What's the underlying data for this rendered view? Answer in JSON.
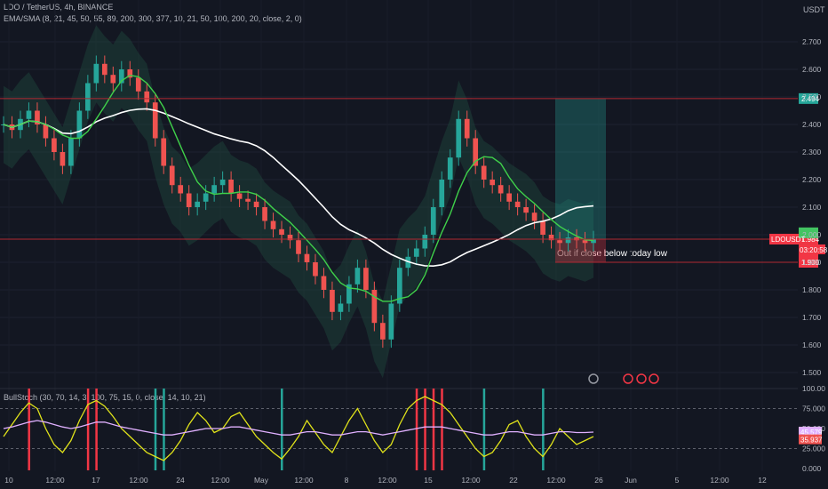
{
  "header": {
    "title": "LDO / TetherUS, 4h, BINANCE",
    "indicator": "EMA/SMA (8, 21, 45, 50, 55, 89, 200, 300, 377, 10, 21, 50, 100, 200, 20, close, 2, 0)",
    "currency": "USDT",
    "sub_indicator": "BullStoch (30, 70, 14, 3, 100, 75, 15, 0, close, 14, 10, 21)"
  },
  "chart_data": [
    {
      "type": "candlestick",
      "title": "LDO / TetherUS, 4h, BINANCE",
      "ylabel": "USDT",
      "ylim": [
        1.5,
        2.8
      ],
      "yticks": [
        "2.700",
        "2.600",
        "2.500",
        "2.400",
        "2.300",
        "2.200",
        "2.100",
        "2.000",
        "1.900",
        "1.800",
        "1.700",
        "1.600",
        "1.500"
      ],
      "xtick_labels": [
        "10",
        "12:00",
        "17",
        "12:00",
        "24",
        "12:00",
        "May",
        "12:00",
        "8",
        "12:00",
        "15",
        "12:00",
        "22",
        "12:00",
        "26",
        "Jun",
        "5",
        "12:00",
        "12"
      ],
      "series": [
        {
          "values": [
            2.4,
            2.38,
            2.42,
            2.45,
            2.4,
            2.35,
            2.3,
            2.25,
            2.35,
            2.45,
            2.55,
            2.62,
            2.58,
            2.55,
            2.6,
            2.57,
            2.52,
            2.48,
            2.35,
            2.25,
            2.18,
            2.15,
            2.1,
            2.12,
            2.15,
            2.18,
            2.2,
            2.15,
            2.13,
            2.12,
            2.1,
            2.05,
            2.02,
            2.0,
            1.98,
            1.93,
            1.9,
            1.85,
            1.8,
            1.72,
            1.75,
            1.82,
            1.88,
            1.8,
            1.68,
            1.62,
            1.75,
            1.88,
            1.92,
            1.95,
            2.0,
            2.1,
            2.2,
            2.28,
            2.42,
            2.35,
            2.25,
            2.2,
            2.18,
            2.15,
            2.12,
            2.1,
            2.08,
            2.05,
            2.0,
            1.98,
            1.97,
            1.99,
            1.98,
            1.97,
            1.984
          ]
        }
      ],
      "levels": [
        {
          "label": "2.494",
          "value": 2.494,
          "color": "#26a69a"
        },
        {
          "label": "1.984",
          "value": 1.984,
          "color": "#f23645"
        },
        {
          "label": "1.900",
          "value": 1.9,
          "color": "#f23645"
        },
        {
          "label": "",
          "value": 2.007,
          "color": "#43c462"
        },
        {
          "label": "",
          "value": 1.932,
          "color": "#f23645"
        }
      ],
      "price_tag": {
        "symbol": "LDOUSDT",
        "price": "1.984",
        "countdown": "03:20:58"
      },
      "annotation": "Out if close below today low",
      "colors": {
        "up": "#26a69a",
        "down": "#ef5350",
        "ema": "#3fd14a",
        "sma": "#ffffff",
        "band": "#1f4a3f",
        "target": "#26a69a",
        "stop": "#f23645"
      }
    },
    {
      "type": "line",
      "title": "BullStoch (30, 70, 14, 3, 100, 75, 15, 0, close, 14, 10, 21)",
      "ylim": [
        0,
        100
      ],
      "yticks": [
        "100.00",
        "75.000",
        "50.000",
        "25.000",
        "0.000"
      ],
      "levels": [
        75,
        25
      ],
      "series": [
        {
          "name": "",
          "color": "#e0e31a",
          "values": [
            40,
            55,
            70,
            82,
            75,
            50,
            30,
            20,
            35,
            60,
            80,
            85,
            78,
            65,
            50,
            40,
            30,
            20,
            15,
            10,
            20,
            35,
            55,
            70,
            60,
            45,
            50,
            65,
            70,
            55,
            40,
            30,
            20,
            12,
            25,
            40,
            60,
            45,
            30,
            20,
            40,
            60,
            75,
            55,
            35,
            20,
            30,
            55,
            75,
            85,
            90,
            85,
            80,
            70,
            55,
            40,
            25,
            15,
            20,
            35,
            55,
            60,
            40,
            25,
            15,
            30,
            50,
            40,
            30,
            35,
            40
          ]
        },
        {
          "name": "",
          "color": "#e0b0ff",
          "values": [
            50,
            52,
            55,
            58,
            60,
            58,
            55,
            52,
            50,
            52,
            55,
            58,
            58,
            55,
            52,
            50,
            48,
            46,
            44,
            42,
            42,
            44,
            46,
            48,
            50,
            50,
            50,
            52,
            52,
            50,
            48,
            46,
            44,
            42,
            42,
            44,
            46,
            46,
            44,
            42,
            42,
            44,
            46,
            46,
            44,
            42,
            44,
            46,
            48,
            50,
            52,
            52,
            52,
            50,
            48,
            46,
            44,
            42,
            42,
            44,
            46,
            46,
            44,
            42,
            42,
            44,
            46,
            46,
            45,
            45,
            45.579
          ]
        }
      ],
      "value_tags": [
        {
          "label": "45.579",
          "color": "#e0b0ff"
        },
        {
          "label": "35.937",
          "color": "#ef5350"
        }
      ]
    }
  ]
}
